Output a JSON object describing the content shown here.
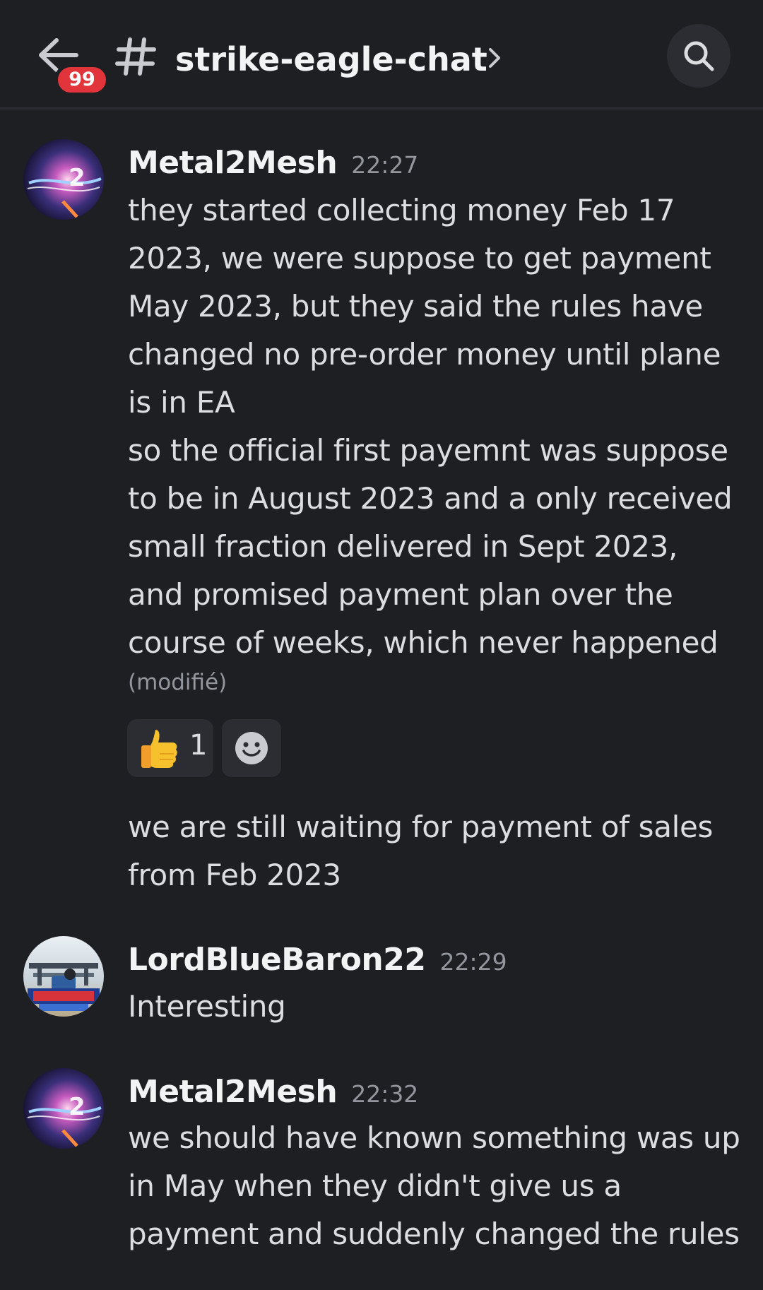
{
  "header": {
    "unread_badge": "99",
    "channel_name": "strike-eagle-chat"
  },
  "messages": [
    {
      "author": "Metal2Mesh",
      "time": "22:27",
      "lines": [
        "they started collecting money Feb 17",
        "2023, we were suppose to get payment",
        "May 2023, but they said the rules have",
        "changed no pre-order money until plane",
        "is in EA",
        "so the official first payemnt was suppose",
        "to be in August 2023 and a only received",
        "small fraction delivered in Sept 2023,",
        "and promised payment plan over the",
        "course of weeks, which never happened"
      ],
      "edited_label": "(modifié)",
      "reaction": {
        "emoji": "👍",
        "count": "1"
      },
      "followup_lines": [
        "we are still waiting for payment of sales",
        "from Feb 2023"
      ]
    },
    {
      "author": "LordBlueBaron22",
      "time": "22:29",
      "lines": [
        "Interesting"
      ]
    },
    {
      "author": "Metal2Mesh",
      "time": "22:32",
      "lines": [
        "we should have known something was up",
        "in May when they didn't give us a",
        "payment and suddenly changed the rules"
      ]
    }
  ],
  "colors": {
    "background": "#1e1f23",
    "badge": "#e2353b",
    "reaction_bg": "#2b2d32",
    "thumb": "#f7c12e"
  },
  "icons": [
    "back-arrow-icon",
    "hash-icon",
    "chevron-right-icon",
    "search-icon",
    "add-reaction-icon"
  ]
}
